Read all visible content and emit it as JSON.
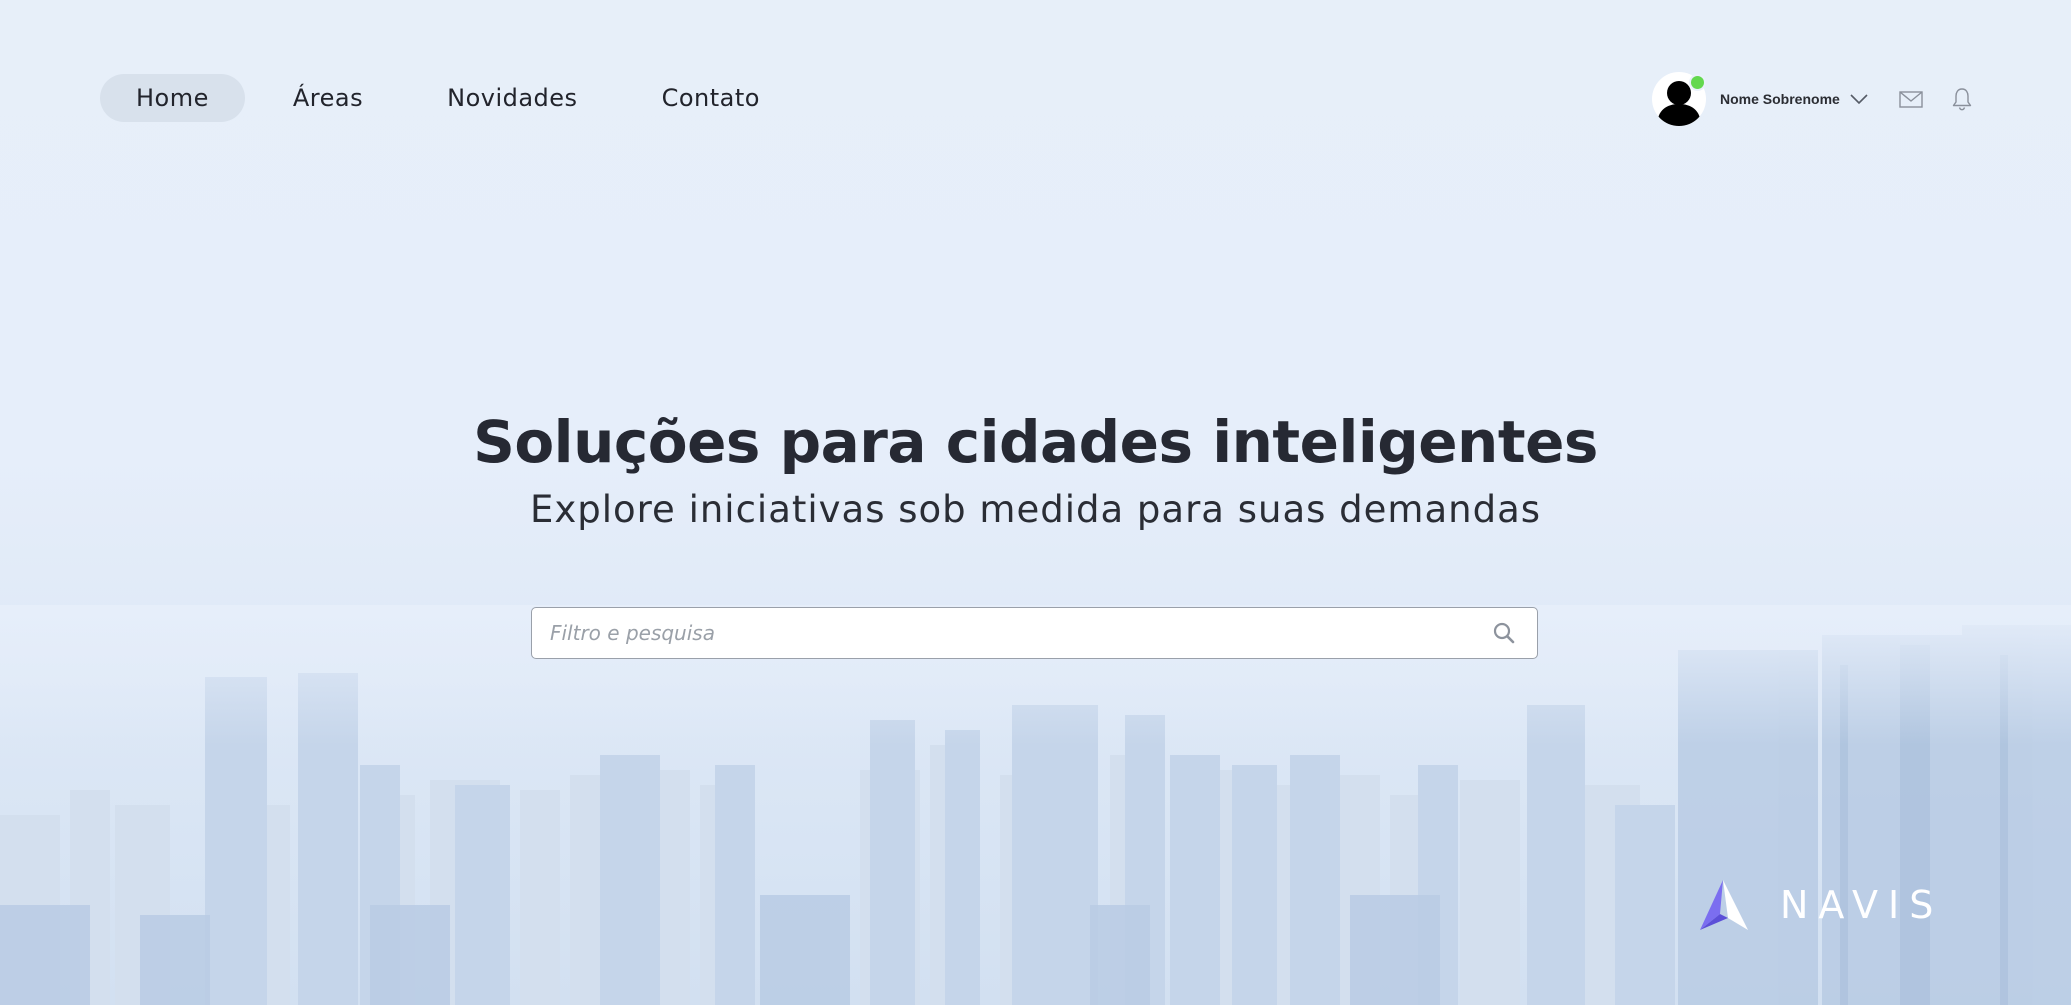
{
  "nav": {
    "items": [
      {
        "label": "Home",
        "active": true
      },
      {
        "label": "Áreas",
        "active": false
      },
      {
        "label": "Novidades",
        "active": false
      },
      {
        "label": "Contato",
        "active": false
      }
    ]
  },
  "user": {
    "name": "Nome Sobrenome",
    "status": "online",
    "status_color": "#63d84e"
  },
  "header_icons": [
    "mail-icon",
    "bell-icon"
  ],
  "hero": {
    "title": "Soluções para cidades inteligentes",
    "subtitle": "Explore iniciativas sob medida para suas demandas"
  },
  "search": {
    "placeholder": "Filtro e pesquisa",
    "value": ""
  },
  "brand": {
    "name": "NAVIS",
    "accent": "#7b6ef0"
  }
}
